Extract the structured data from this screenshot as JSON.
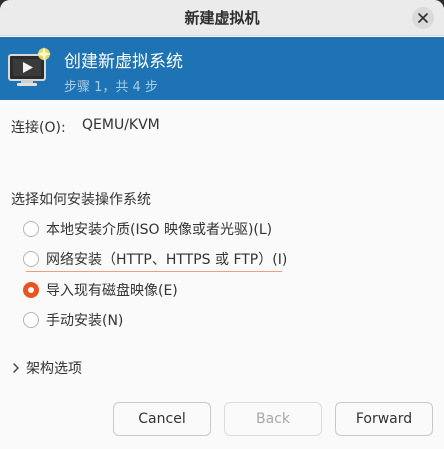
{
  "window": {
    "title": "新建虚拟机"
  },
  "banner": {
    "title": "创建新虚拟系统",
    "step": "步骤 1，共 4 步",
    "icon": "vm-monitor-icon"
  },
  "connection": {
    "label": "连接(O):",
    "value": "QEMU/KVM"
  },
  "install": {
    "heading": "选择如何安装操作系统",
    "options": [
      {
        "label": "本地安装介质(ISO 映像或者光驱)(L)",
        "checked": false
      },
      {
        "label": "网络安装（HTTP、HTTPS 或 FTP）(I)",
        "checked": false
      },
      {
        "label": "导入现有磁盘映像(E)",
        "checked": true
      },
      {
        "label": "手动安装(N)",
        "checked": false
      }
    ]
  },
  "architecture": {
    "label": "架构选项",
    "icon": "chevron-right-icon"
  },
  "buttons": {
    "cancel": "Cancel",
    "back": "Back",
    "forward": "Forward"
  },
  "colors": {
    "banner": "#1e73b4",
    "accent": "#e95420"
  }
}
